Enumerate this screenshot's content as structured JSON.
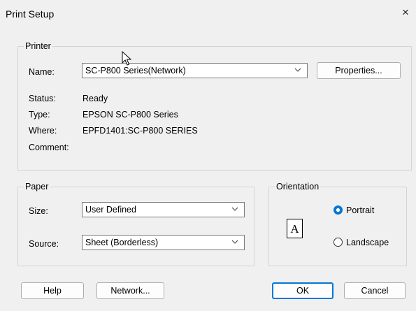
{
  "window": {
    "title": "Print Setup",
    "close_glyph": "×"
  },
  "printer": {
    "group_label": "Printer",
    "name_label": "Name:",
    "name_value": "SC-P800 Series(Network)",
    "properties_label": "Properties...",
    "status_label": "Status:",
    "status_value": "Ready",
    "type_label": "Type:",
    "type_value": "EPSON SC-P800 Series",
    "where_label": "Where:",
    "where_value": "EPFD1401:SC-P800 SERIES",
    "comment_label": "Comment:",
    "comment_value": ""
  },
  "paper": {
    "group_label": "Paper",
    "size_label": "Size:",
    "size_value": "User Defined",
    "source_label": "Source:",
    "source_value": "Sheet (Borderless)"
  },
  "orientation": {
    "group_label": "Orientation",
    "portrait_label": "Portrait",
    "landscape_label": "Landscape",
    "selected": "Portrait",
    "icon_letter": "A"
  },
  "buttons": {
    "help": "Help",
    "network": "Network...",
    "ok": "OK",
    "cancel": "Cancel"
  },
  "colors": {
    "accent": "#0078d7",
    "background": "#f0f0f0",
    "border": "#d4d4d4"
  }
}
